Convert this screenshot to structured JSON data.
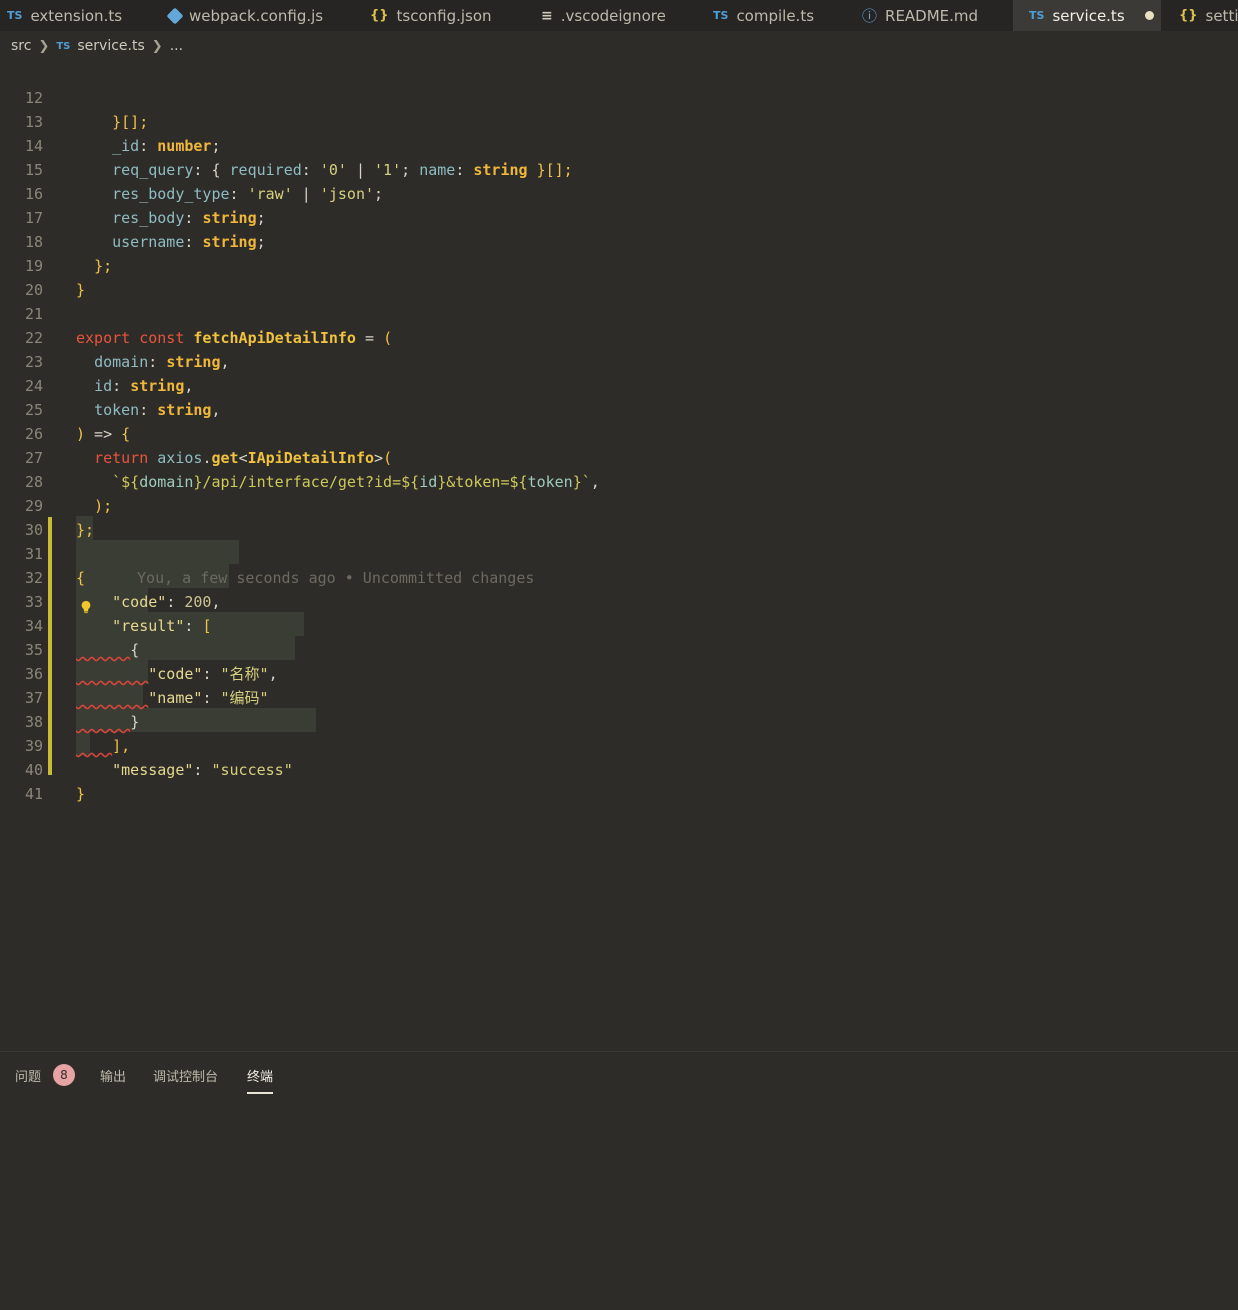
{
  "tabs": [
    {
      "label": "extension.ts",
      "icon": "ts-icon"
    },
    {
      "label": "webpack.config.js",
      "icon": "webpack-icon"
    },
    {
      "label": "tsconfig.json",
      "icon": "json-icon"
    },
    {
      "label": ".vscodeignore",
      "icon": "ignore-file-icon"
    },
    {
      "label": "compile.ts",
      "icon": "ts-icon"
    },
    {
      "label": "README.md",
      "icon": "info-icon"
    },
    {
      "label": "service.ts",
      "icon": "ts-icon",
      "active": true,
      "modified": true
    },
    {
      "label": "settin",
      "icon": "json-icon"
    }
  ],
  "icon_glyphs": {
    "ts": "TS",
    "json": "{}",
    "ignore": "≡",
    "info": "ⓘ"
  },
  "breadcrumb": {
    "folder": "src",
    "file": "service.ts",
    "more": "..."
  },
  "editor": {
    "line_numbers": [
      "12",
      "13",
      "14",
      "15",
      "16",
      "17",
      "18",
      "19",
      "20",
      "21",
      "22",
      "23",
      "24",
      "25",
      "26",
      "27",
      "28",
      "29",
      "30",
      "31",
      "32",
      "33",
      "34",
      "35",
      "36",
      "37",
      "38",
      "39",
      "40",
      "41"
    ],
    "blame": "You, a few seconds ago • Uncommitted changes",
    "tokens": {
      "l12": [
        "    ",
        "}[];"
      ],
      "l13": [
        "    ",
        "_id",
        ": ",
        "number",
        ";"
      ],
      "l14": [
        "    ",
        "req_query",
        ": { ",
        "required",
        ": ",
        "'0'",
        " | ",
        "'1'",
        "; ",
        "name",
        ": ",
        "string",
        " }[];"
      ],
      "l15": [
        "    ",
        "res_body_type",
        ": ",
        "'raw'",
        " | ",
        "'json'",
        ";"
      ],
      "l16": [
        "    ",
        "res_body",
        ": ",
        "string",
        ";"
      ],
      "l17": [
        "    ",
        "username",
        ": ",
        "string",
        ";"
      ],
      "l18": [
        "  ",
        "};"
      ],
      "l19": [
        "}"
      ],
      "l21": [
        "export",
        " ",
        "const",
        " ",
        "fetchApiDetailInfo",
        " = ",
        "("
      ],
      "l22": [
        "  ",
        "domain",
        ": ",
        "string",
        ","
      ],
      "l23": [
        "  ",
        "id",
        ": ",
        "string",
        ","
      ],
      "l24": [
        "  ",
        "token",
        ": ",
        "string",
        ","
      ],
      "l25": [
        ")",
        " => ",
        "{"
      ],
      "l26": [
        "  ",
        "return",
        " ",
        "axios",
        ".",
        "get",
        "<",
        "IApiDetailInfo",
        ">",
        "("
      ],
      "l27": [
        "    ",
        "`${",
        "domain",
        "}/api/interface/get?id=${",
        "id",
        "}&token=${",
        "token",
        "}`",
        ","
      ],
      "l28": [
        "  ",
        ");"
      ],
      "l29": [
        "};"
      ],
      "l31": [
        "{"
      ],
      "l32": [
        "    ",
        "\"code\"",
        ": ",
        "200",
        ","
      ],
      "l33": [
        "    ",
        "\"result\"",
        ": ",
        "["
      ],
      "l34": [
        "      ",
        "{"
      ],
      "l35": [
        "        ",
        "\"code\"",
        ": ",
        "\"名称\"",
        ","
      ],
      "l36": [
        "        ",
        "\"name\"",
        ": ",
        "\"编码\""
      ],
      "l37": [
        "      ",
        "}"
      ],
      "l38": [
        "    ",
        "],"
      ],
      "l39": [
        "    ",
        "\"message\"",
        ": ",
        "\"success\""
      ],
      "l40": [
        "}"
      ]
    }
  },
  "panel": {
    "tabs": [
      {
        "label": "问题"
      },
      {
        "label": "输出"
      },
      {
        "label": "调试控制台"
      },
      {
        "label": "终端",
        "active": true
      }
    ],
    "problems_count": "8"
  },
  "colors": {
    "background": "#2d2c28",
    "tabbar": "#262523",
    "git_modified": "#c8bc35",
    "keyword": "#e8543c",
    "function": "#f0c23d",
    "string": "#d8cf7e",
    "property": "#8fbcc2",
    "badge": "#e7a2a4"
  }
}
